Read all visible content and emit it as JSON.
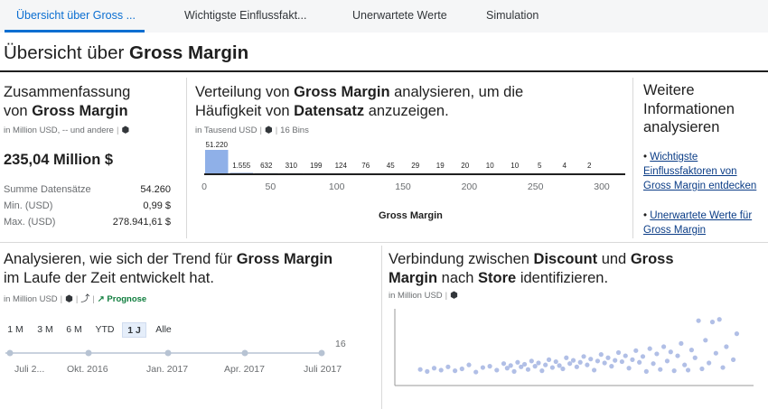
{
  "tabs": [
    {
      "label": "Übersicht über Gross ..."
    },
    {
      "label": "Wichtigste Einflussfakt..."
    },
    {
      "label": "Unerwartete Werte"
    },
    {
      "label": "Simulation"
    }
  ],
  "page": {
    "title_prefix": "Übersicht über ",
    "title_bold": "Gross Margin"
  },
  "summary": {
    "title_line1": "Zusammenfassung",
    "title_prefix": "von ",
    "title_bold": "Gross Margin",
    "subtitle": "in Million USD, -- und andere",
    "big_value": "235,04 Million $",
    "rows": [
      {
        "label": "Summe Datensätze",
        "value": "54.260"
      },
      {
        "label": "Min. (USD)",
        "value": "0,99 $"
      },
      {
        "label": "Max. (USD)",
        "value": "278.941,61 $"
      }
    ]
  },
  "distribution": {
    "t1": "Verteilung von ",
    "t2": "Gross Margin",
    "t3": " analysieren, um die",
    "t4": "Häufigkeit von ",
    "t5": "Datensatz",
    "t6": " anzuzeigen.",
    "subtitle": "in Tausend USD",
    "bins_label": "16 Bins",
    "x_axis_title": "Gross Margin"
  },
  "further": {
    "title": "Weitere Informationen analysieren",
    "links": [
      {
        "text": "Wichtigste Einflussfaktoren von Gross Margin entdecken"
      },
      {
        "text": "Unerwartete Werte für Gross Margin"
      }
    ]
  },
  "trend": {
    "t1": "Analysieren, wie sich der Trend für ",
    "t2": "Gross Margin",
    "t3": "im Laufe der Zeit entwickelt hat.",
    "subtitle": "in Million USD",
    "forecast": "Prognose",
    "ranges": [
      "1 M",
      "3 M",
      "6 M",
      "YTD",
      "1 J",
      "Alle"
    ],
    "selected_range": "1 J",
    "y_max": "16",
    "dates": [
      "Juli 2...",
      "Okt. 2016",
      "Jan. 2017",
      "Apr. 2017",
      "Juli 2017"
    ]
  },
  "correlation": {
    "t1": "Verbindung zwischen ",
    "t2": "Discount",
    "t3": " und ",
    "t4": "Gross",
    "t5": "Margin",
    "t6": " nach ",
    "t7": "Store",
    "t8": " identifizieren.",
    "subtitle": "in Million USD"
  },
  "colors": {
    "accent": "#0a6ed1",
    "bar": "#a9bde6",
    "bar_first": "#8fb0e8",
    "point": "#a8b8e3",
    "forecast": "#107e3e"
  },
  "chart_data": [
    {
      "type": "bar",
      "categories": [
        "0-18.75",
        "18.75-37.5",
        "37.5-56.25",
        "56.25-75",
        "75-93.75",
        "93.75-112.5",
        "112.5-131.25",
        "131.25-150",
        "150-168.75",
        "168.75-187.5",
        "187.5-206.25",
        "206.25-225",
        "225-243.75",
        "243.75-262.5",
        "262.5-281.25",
        "281.25-300"
      ],
      "values": [
        51220,
        1555,
        632,
        310,
        199,
        124,
        76,
        45,
        29,
        19,
        20,
        10,
        10,
        5,
        4,
        2
      ],
      "value_labels": [
        "51.220",
        "1.555",
        "632",
        "310",
        "199",
        "124",
        "76",
        "45",
        "29",
        "19",
        "20",
        "10",
        "10",
        "5",
        "4",
        "2"
      ],
      "x_ticks": [
        0,
        50,
        100,
        150,
        200,
        250,
        300
      ],
      "xlabel": "Gross Margin",
      "xlim": [
        0,
        300
      ]
    },
    {
      "type": "scatter",
      "points": [
        [
          0.06,
          0.15
        ],
        [
          0.08,
          0.12
        ],
        [
          0.1,
          0.17
        ],
        [
          0.12,
          0.14
        ],
        [
          0.14,
          0.19
        ],
        [
          0.16,
          0.13
        ],
        [
          0.18,
          0.16
        ],
        [
          0.2,
          0.22
        ],
        [
          0.22,
          0.11
        ],
        [
          0.24,
          0.18
        ],
        [
          0.26,
          0.2
        ],
        [
          0.28,
          0.14
        ],
        [
          0.3,
          0.24
        ],
        [
          0.31,
          0.17
        ],
        [
          0.32,
          0.21
        ],
        [
          0.33,
          0.12
        ],
        [
          0.34,
          0.26
        ],
        [
          0.35,
          0.19
        ],
        [
          0.36,
          0.23
        ],
        [
          0.37,
          0.15
        ],
        [
          0.38,
          0.28
        ],
        [
          0.39,
          0.2
        ],
        [
          0.4,
          0.25
        ],
        [
          0.41,
          0.13
        ],
        [
          0.42,
          0.22
        ],
        [
          0.43,
          0.3
        ],
        [
          0.44,
          0.18
        ],
        [
          0.45,
          0.27
        ],
        [
          0.46,
          0.21
        ],
        [
          0.47,
          0.16
        ],
        [
          0.48,
          0.33
        ],
        [
          0.49,
          0.24
        ],
        [
          0.5,
          0.29
        ],
        [
          0.51,
          0.19
        ],
        [
          0.52,
          0.26
        ],
        [
          0.53,
          0.35
        ],
        [
          0.54,
          0.22
        ],
        [
          0.55,
          0.31
        ],
        [
          0.56,
          0.14
        ],
        [
          0.57,
          0.28
        ],
        [
          0.58,
          0.38
        ],
        [
          0.59,
          0.25
        ],
        [
          0.6,
          0.33
        ],
        [
          0.61,
          0.2
        ],
        [
          0.62,
          0.29
        ],
        [
          0.63,
          0.41
        ],
        [
          0.64,
          0.27
        ],
        [
          0.65,
          0.36
        ],
        [
          0.66,
          0.17
        ],
        [
          0.67,
          0.3
        ],
        [
          0.68,
          0.44
        ],
        [
          0.69,
          0.26
        ],
        [
          0.7,
          0.35
        ],
        [
          0.71,
          0.12
        ],
        [
          0.72,
          0.47
        ],
        [
          0.73,
          0.24
        ],
        [
          0.74,
          0.39
        ],
        [
          0.75,
          0.15
        ],
        [
          0.76,
          0.5
        ],
        [
          0.77,
          0.28
        ],
        [
          0.78,
          0.42
        ],
        [
          0.79,
          0.13
        ],
        [
          0.8,
          0.36
        ],
        [
          0.81,
          0.55
        ],
        [
          0.82,
          0.22
        ],
        [
          0.83,
          0.14
        ],
        [
          0.84,
          0.45
        ],
        [
          0.85,
          0.33
        ],
        [
          0.86,
          0.9
        ],
        [
          0.87,
          0.16
        ],
        [
          0.88,
          0.6
        ],
        [
          0.89,
          0.25
        ],
        [
          0.9,
          0.88
        ],
        [
          0.91,
          0.4
        ],
        [
          0.92,
          0.92
        ],
        [
          0.93,
          0.18
        ],
        [
          0.94,
          0.5
        ],
        [
          0.96,
          0.3
        ],
        [
          0.97,
          0.7
        ]
      ]
    }
  ]
}
